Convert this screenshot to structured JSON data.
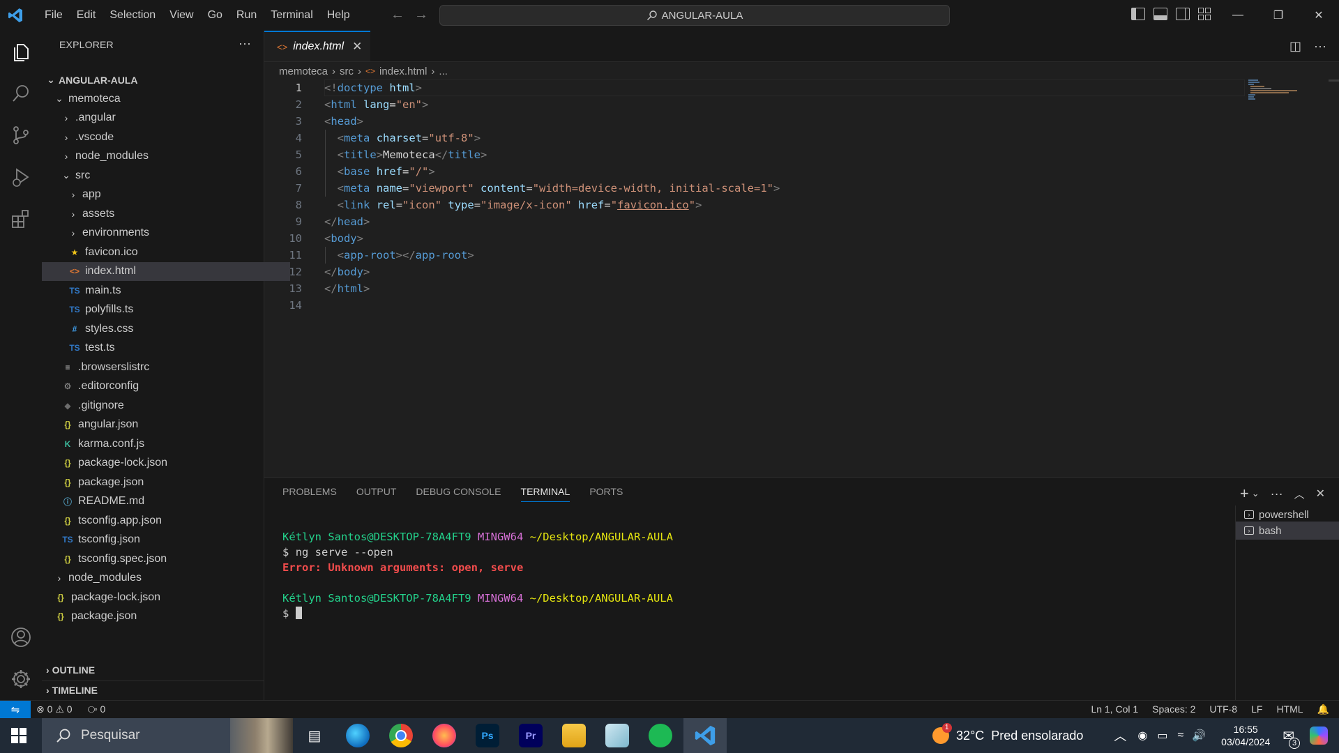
{
  "titlebar": {
    "menu": [
      "File",
      "Edit",
      "Selection",
      "View",
      "Go",
      "Run",
      "Terminal",
      "Help"
    ],
    "command_center": "ANGULAR-AULA"
  },
  "sidebar": {
    "title": "EXPLORER",
    "root": "ANGULAR-AULA",
    "items": [
      {
        "label": "memoteca",
        "icon": "chevron-down-icon"
      },
      {
        "label": ".angular",
        "icon": "chevron-right-icon"
      },
      {
        "label": ".vscode",
        "icon": "chevron-right-icon"
      },
      {
        "label": "node_modules",
        "icon": "chevron-right-icon"
      },
      {
        "label": "src",
        "icon": "chevron-down-icon"
      },
      {
        "label": "app",
        "icon": "chevron-right-icon"
      },
      {
        "label": "assets",
        "icon": "chevron-right-icon"
      },
      {
        "label": "environments",
        "icon": "chevron-right-icon"
      },
      {
        "label": "favicon.ico",
        "icon": "star-icon"
      },
      {
        "label": "index.html",
        "icon": "html-icon"
      },
      {
        "label": "main.ts",
        "icon": "ts-icon"
      },
      {
        "label": "polyfills.ts",
        "icon": "ts-icon"
      },
      {
        "label": "styles.css",
        "icon": "css-icon"
      },
      {
        "label": "test.ts",
        "icon": "ts-icon"
      },
      {
        "label": ".browserslistrc",
        "icon": "lines-icon"
      },
      {
        "label": ".editorconfig",
        "icon": "gear-icon"
      },
      {
        "label": ".gitignore",
        "icon": "git-icon"
      },
      {
        "label": "angular.json",
        "icon": "json-icon"
      },
      {
        "label": "karma.conf.js",
        "icon": "karma-icon"
      },
      {
        "label": "package-lock.json",
        "icon": "json-icon"
      },
      {
        "label": "package.json",
        "icon": "json-icon"
      },
      {
        "label": "README.md",
        "icon": "info-icon"
      },
      {
        "label": "tsconfig.app.json",
        "icon": "json-icon"
      },
      {
        "label": "tsconfig.json",
        "icon": "tsconfig-icon"
      },
      {
        "label": "tsconfig.spec.json",
        "icon": "json-icon"
      },
      {
        "label": "node_modules",
        "icon": "chevron-right-icon"
      },
      {
        "label": "package-lock.json",
        "icon": "json-icon"
      },
      {
        "label": "package.json",
        "icon": "json-icon"
      }
    ],
    "outline": "OUTLINE",
    "timeline": "TIMELINE"
  },
  "editor": {
    "tab": "index.html",
    "breadcrumb": [
      "memoteca",
      "src",
      "index.html",
      "..."
    ],
    "line_numbers": [
      "1",
      "2",
      "3",
      "4",
      "5",
      "6",
      "7",
      "8",
      "9",
      "10",
      "11",
      "12",
      "13",
      "14"
    ]
  },
  "panel": {
    "tabs": [
      "PROBLEMS",
      "OUTPUT",
      "DEBUG CONSOLE",
      "TERMINAL",
      "PORTS"
    ],
    "active_tab": "TERMINAL",
    "terminal": {
      "user": "Kétlyn Santos@DESKTOP-78A4FT9",
      "shell": "MINGW64",
      "path": "~/Desktop/ANGULAR-AULA",
      "prompt": "$",
      "command": "ng serve --open",
      "error": "Error: Unknown arguments: open, serve"
    },
    "terminals": [
      "powershell",
      "bash"
    ]
  },
  "statusbar": {
    "errors": "0",
    "warnings": "0",
    "ports": "0",
    "position": "Ln 1, Col 1",
    "spaces": "Spaces: 2",
    "encoding": "UTF-8",
    "eol": "LF",
    "language": "HTML"
  },
  "taskbar": {
    "search_placeholder": "Pesquisar",
    "weather": "32°C  Pred ensolarado",
    "weather_badge": "1",
    "time": "16:55",
    "date": "03/04/2024",
    "notification_count": "3"
  }
}
